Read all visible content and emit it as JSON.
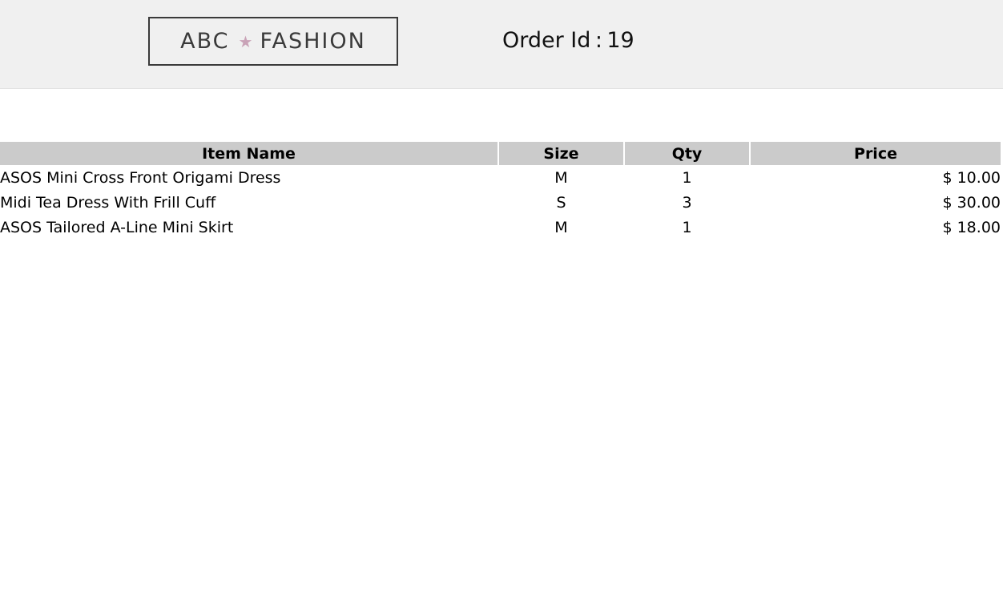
{
  "header": {
    "logo": {
      "left_text": "ABC",
      "star_icon": "star-icon",
      "right_text": "FASHION",
      "star_color": "#c9a3b7"
    },
    "order_label": "Order Id",
    "order_separator": ":",
    "order_id": "19"
  },
  "table": {
    "columns": {
      "name": "Item Name",
      "size": "Size",
      "qty": "Qty",
      "price": "Price"
    },
    "rows": [
      {
        "name": "ASOS Mini Cross Front Origami Dress",
        "size": "M",
        "qty": "1",
        "price": "$ 10.00"
      },
      {
        "name": "Midi Tea Dress With Frill Cuff",
        "size": "S",
        "qty": "3",
        "price": "$ 30.00"
      },
      {
        "name": "ASOS Tailored A-Line Mini Skirt",
        "size": "M",
        "qty": "1",
        "price": "$ 18.00"
      }
    ]
  },
  "colors": {
    "header_bg": "#f0f0f0",
    "table_header_bg": "#cbcbcb"
  }
}
